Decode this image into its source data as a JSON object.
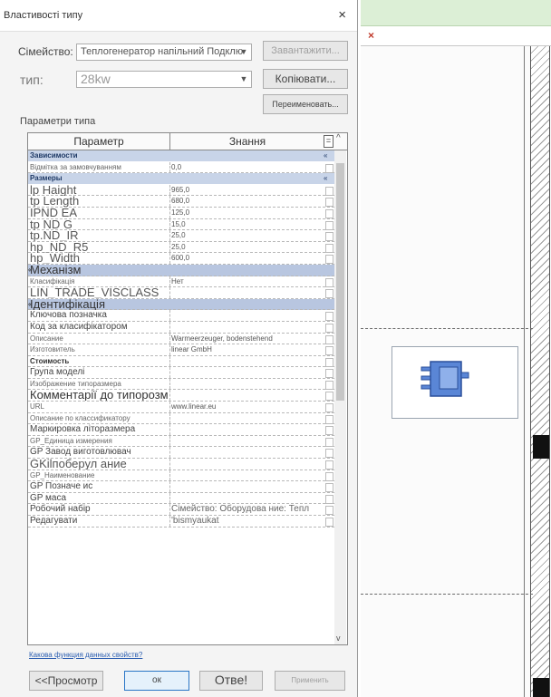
{
  "dialog": {
    "title": "Властивості типу",
    "close_glyph": "×",
    "family_label": "Сімейство:",
    "family_value": "Теплогенератор напільний Подклю",
    "load_button": "Завантажити...",
    "type_label": "тип:",
    "type_value": "28kw",
    "duplicate_button": "Копіювати...",
    "rename_button": "Переименовать...",
    "params_title": "Параметри типа",
    "col_param": "Параметр",
    "col_value": "Знання",
    "help_link": "Какова функция данных свойств?",
    "preview_button": "<<Просмотр",
    "ok_button": "ок",
    "cancel_button": "Отве!",
    "apply_button": "Применить"
  },
  "rows": [
    {
      "type": "group",
      "label": "Зависимости",
      "star": "«"
    },
    {
      "type": "plain",
      "label": "Відмітка за замовчуванням",
      "value": "0,0"
    },
    {
      "type": "group",
      "label": "Размеры",
      "star": "«"
    },
    {
      "type": "big",
      "label": "lp Haight",
      "value": "965,0"
    },
    {
      "type": "big",
      "label": "tp Length",
      "value": "680,0"
    },
    {
      "type": "big",
      "label": "IPND EA",
      "value": "125,0"
    },
    {
      "type": "big",
      "label": "tp ND G",
      "value": "15,0"
    },
    {
      "type": "big",
      "label": "tp.ND_IR",
      "value": "25,0"
    },
    {
      "type": "big",
      "label": "hp_ND_R5",
      "value": "25,0"
    },
    {
      "type": "big",
      "label": "hp_Width",
      "value": "600,0"
    },
    {
      "type": "bluebig",
      "label": "Механізм",
      "star": "«"
    },
    {
      "type": "plain",
      "label": "Класифікація",
      "value": "Нет"
    },
    {
      "type": "big",
      "label": "LIN_TRADE_VISCLASS",
      "value": ""
    },
    {
      "type": "bluebig",
      "label": "Ідентифікація",
      "star": "«"
    },
    {
      "type": "mid",
      "label": "Ключова позначка",
      "value": ""
    },
    {
      "type": "mid",
      "label": "Код за класифікатором",
      "value": ""
    },
    {
      "type": "plain",
      "label": "Описание",
      "value": "Warmeerzeuger, bodenstehend"
    },
    {
      "type": "plain",
      "label": "Изготовитель",
      "value": "linear GmbH"
    },
    {
      "type": "dark",
      "label": "Стоимость",
      "value": ""
    },
    {
      "type": "mid",
      "label": "Група моделі",
      "value": ""
    },
    {
      "type": "plain",
      "label": "Изображение типоразмера",
      "value": ""
    },
    {
      "type": "huge",
      "label": "Комментарії до типорозміру",
      "value": ""
    },
    {
      "type": "plain",
      "label": "URL",
      "value": "www.linear.eu"
    },
    {
      "type": "plain",
      "label": "Описание по классификатору",
      "value": ""
    },
    {
      "type": "mid",
      "label": "Маркировка літоразмера",
      "value": ""
    },
    {
      "type": "plain",
      "label": "GP_Единица измерения",
      "value": ""
    },
    {
      "type": "mid",
      "label": "GP Завод виготовлювач",
      "value": ""
    },
    {
      "type": "big",
      "label": "GKilпоберул ание",
      "value": ""
    },
    {
      "type": "plain",
      "label": "GP_Наименование",
      "value": ""
    },
    {
      "type": "mid",
      "label": "GP Позначе ис",
      "value": ""
    },
    {
      "type": "mid",
      "label": "GP маса",
      "value": ""
    },
    {
      "type": "mid",
      "label": "Робочий набір",
      "value": "Сімейство: Оборудова ние: Тепл"
    },
    {
      "type": "mid",
      "label": "Редагувати",
      "value": "'bismyaukat"
    }
  ]
}
